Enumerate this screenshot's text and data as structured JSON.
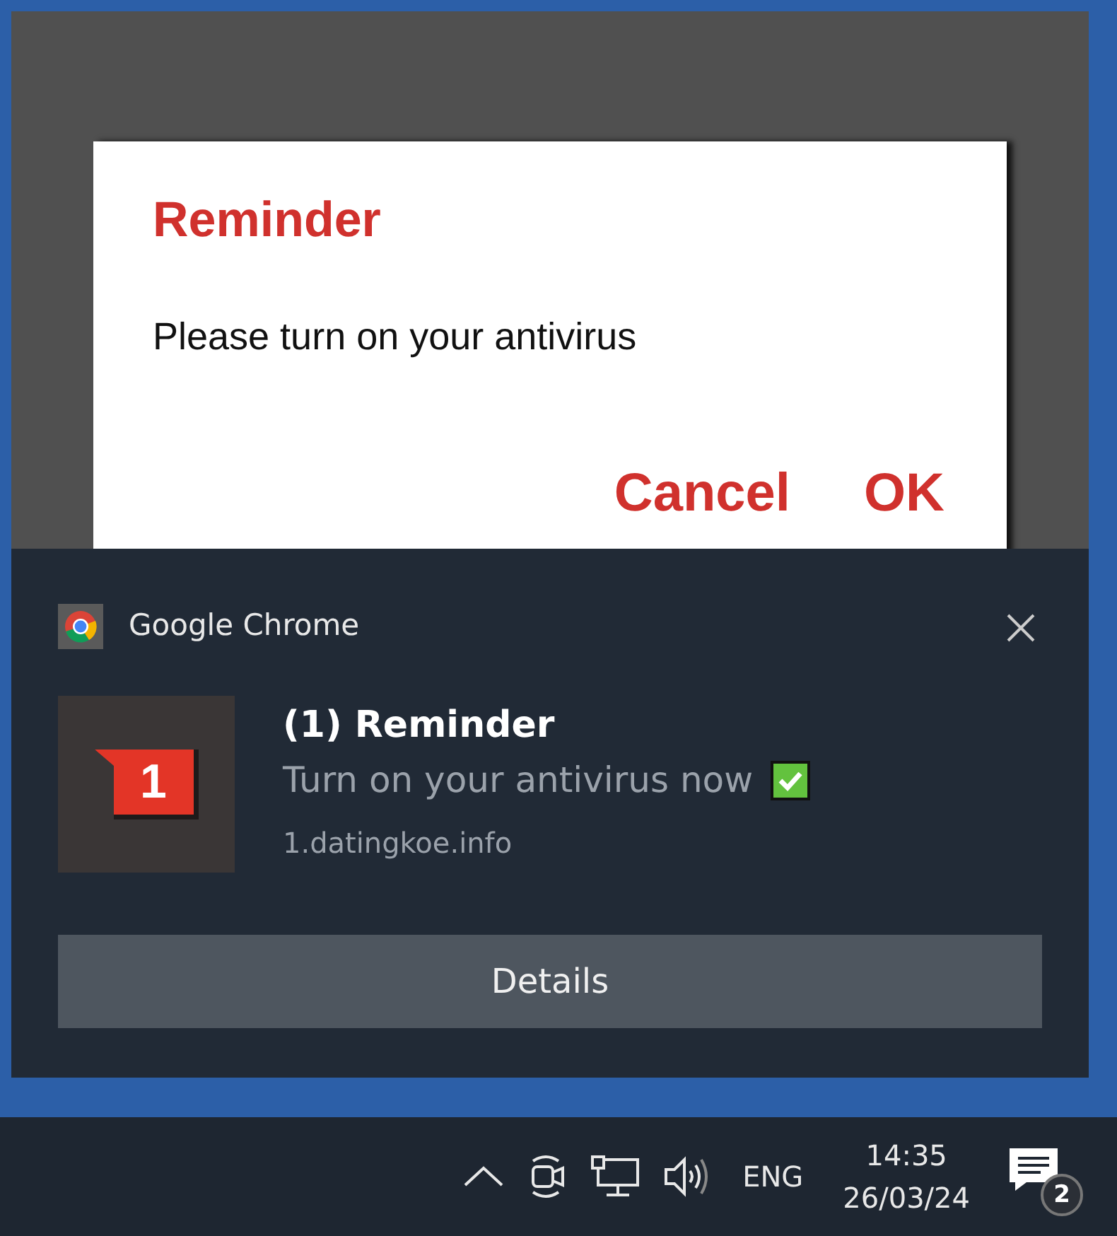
{
  "dialog": {
    "title": "Reminder",
    "message": "Please turn on your antivirus",
    "buttons": [
      "Cancel",
      "OK"
    ]
  },
  "notification": {
    "app": "Google Chrome",
    "title": "(1) Reminder",
    "body": "Turn on your antivirus now",
    "source": "1.datingkoe.info",
    "badge": "1",
    "button": "Details"
  },
  "taskbar": {
    "language": "ENG",
    "time": "14:35",
    "date": "26/03/24",
    "notification_count": "2"
  }
}
